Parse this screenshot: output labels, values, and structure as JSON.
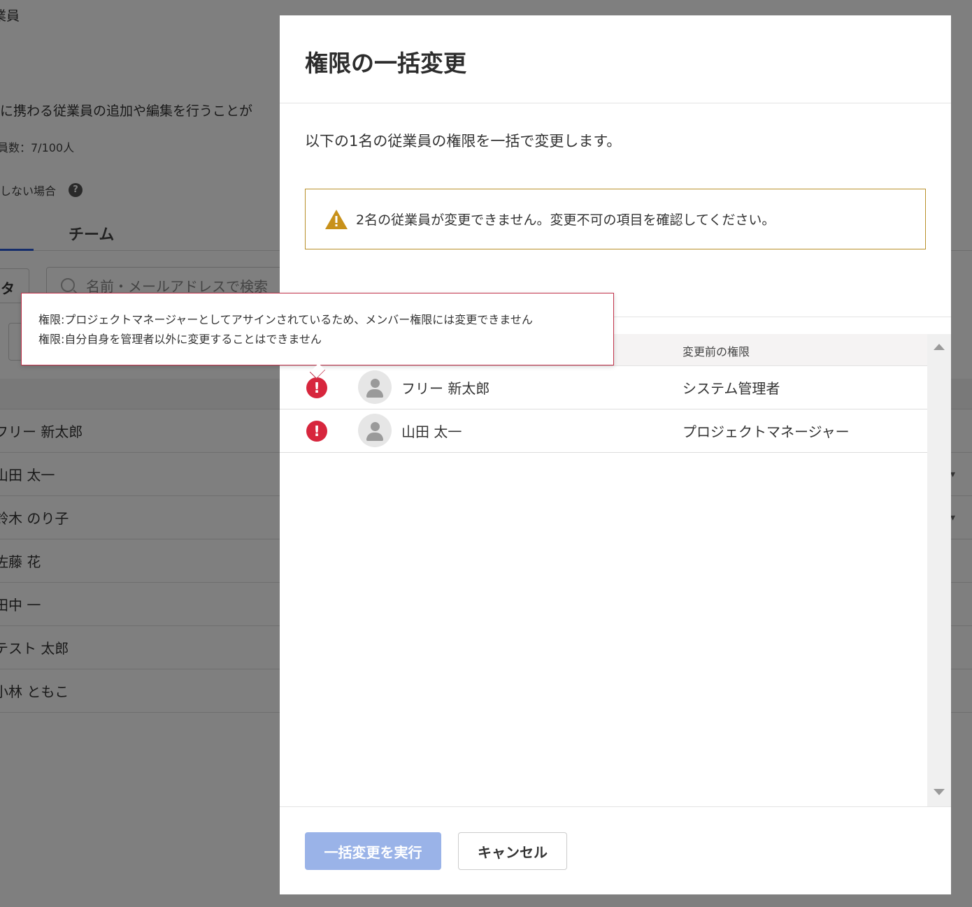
{
  "background": {
    "title": "業員",
    "description": "に携わる従業員の追加や編集を行うことが",
    "employee_count": "員数：7/100人",
    "notice": "しない場合",
    "tab_team": "チーム",
    "filter_label": "タ",
    "search_placeholder": "名前・メールアドレスで検索",
    "rows": [
      "フリー 新太郎",
      "山田 太一",
      "鈴木 のり子",
      "佐藤 花",
      "田中 一",
      "テスト 太郎",
      "小林 ともこ"
    ]
  },
  "modal": {
    "title": "権限の一括変更",
    "lead": "以下の1名の従業員の権限を一括で変更します。",
    "warning": "2名の従業員が変更できません。変更不可の項目を確認してください。",
    "table": {
      "header_before": "変更前の権限",
      "rows": [
        {
          "name": "フリー 新太郎",
          "role": "システム管理者",
          "error": "!"
        },
        {
          "name": "山田 太一",
          "role": "プロジェクトマネージャー",
          "error": "!"
        }
      ]
    },
    "footer": {
      "execute_label": "一括変更を実行",
      "cancel_label": "キャンセル"
    }
  },
  "tooltip": {
    "lines": [
      "権限:プロジェクトマネージャーとしてアサインされているため、メンバー権限には変更できません",
      "権限:自分自身を管理者以外に変更することはできません"
    ]
  },
  "colors": {
    "overlay": "#808080",
    "warning_border": "#b8902a",
    "warning_icon": "#c8911a",
    "error": "#d7263d",
    "primary_disabled": "#9ab3e8",
    "accent": "#2b5bd7"
  }
}
